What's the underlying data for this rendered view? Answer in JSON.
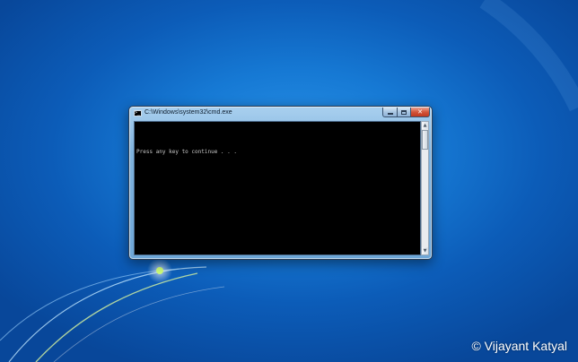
{
  "window": {
    "title": "C:\\Windows\\system32\\cmd.exe",
    "icon": "cmd-icon"
  },
  "console": {
    "lines": [
      "",
      "Press any key to continue . . ."
    ]
  },
  "watermark": "© Vijayant Katyal",
  "colors": {
    "desktop_blue": "#1679d4",
    "console_bg": "#000000",
    "close_red": "#c0391f"
  }
}
